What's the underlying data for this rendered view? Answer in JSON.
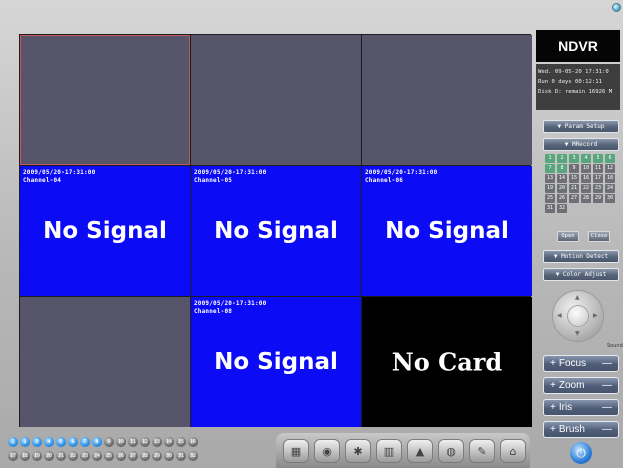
{
  "app": {
    "brand": "NDVR"
  },
  "status": {
    "line1": "Wed.  09-05-20 17:31:0",
    "line2": "Run 0 days 00:12:11",
    "line3": "Disk D: remain 16926 M"
  },
  "cells": [
    {
      "kind": "empty",
      "timestamp": "",
      "channel": "",
      "message": ""
    },
    {
      "kind": "empty",
      "timestamp": "",
      "channel": "",
      "message": ""
    },
    {
      "kind": "empty",
      "timestamp": "",
      "channel": "",
      "message": ""
    },
    {
      "kind": "blue",
      "timestamp": "2009/05/20-17:31:00",
      "channel": "Channel-04",
      "message": "No Signal"
    },
    {
      "kind": "blue",
      "timestamp": "2009/05/20-17:31:00",
      "channel": "Channel-05",
      "message": "No Signal"
    },
    {
      "kind": "blue",
      "timestamp": "2009/05/20-17:31:00",
      "channel": "Channel-06",
      "message": "No Signal"
    },
    {
      "kind": "empty",
      "timestamp": "",
      "channel": "",
      "message": ""
    },
    {
      "kind": "blue",
      "timestamp": "2009/05/20-17:31:00",
      "channel": "Channel-08",
      "message": "No Signal"
    },
    {
      "kind": "black",
      "timestamp": "",
      "channel": "",
      "message": "No Card"
    }
  ],
  "panel": {
    "param_setup": "▼ Param Setup",
    "record": "▼ MRecord",
    "motion_detect": "▼ Motion Detect",
    "color_adjust": "▼ Color Adjust",
    "open": "Open",
    "close": "Close",
    "sound": "Sound",
    "record_channels": {
      "on": [
        "1",
        "2",
        "3",
        "4",
        "5",
        "6",
        "7",
        "8"
      ],
      "off": [
        "9",
        "10",
        "11",
        "12",
        "13",
        "14",
        "15",
        "16",
        "17",
        "18",
        "19",
        "20",
        "21",
        "22",
        "23",
        "24",
        "25",
        "26",
        "27",
        "28",
        "29",
        "30",
        "31",
        "32"
      ]
    }
  },
  "controls": {
    "focus": "Focus",
    "zoom": "Zoom",
    "iris": "Iris",
    "brush": "Brush",
    "plus": "+",
    "minus": "—"
  },
  "bottom": {
    "row1_blue": [
      "1",
      "2",
      "3",
      "4",
      "5",
      "6",
      "7",
      "8"
    ],
    "row1_gray": [
      "9",
      "10",
      "11",
      "12",
      "13",
      "14",
      "15",
      "16"
    ],
    "row2_gray": [
      "17",
      "18",
      "19",
      "20",
      "21",
      "22",
      "23",
      "24",
      "25",
      "26",
      "27",
      "28",
      "29",
      "30",
      "31",
      "32"
    ],
    "tools": [
      "layout-icon",
      "playback-icon",
      "search-icon",
      "split-icon",
      "snapshot-icon",
      "config-icon",
      "edit-icon",
      "lock-icon"
    ]
  }
}
